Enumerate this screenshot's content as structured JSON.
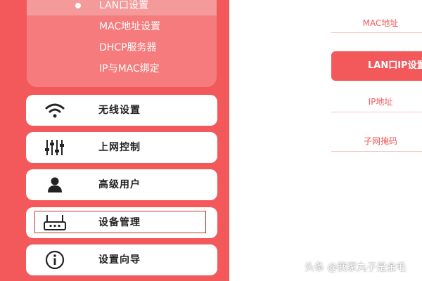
{
  "sidebar": {
    "submenu": [
      {
        "label": "LAN口设置",
        "active": true
      },
      {
        "label": "MAC地址设置",
        "active": false
      },
      {
        "label": "DHCP服务器",
        "active": false
      },
      {
        "label": "IP与MAC绑定",
        "active": false
      }
    ],
    "menu": [
      {
        "label": "无线设置",
        "icon": "wifi-icon"
      },
      {
        "label": "上网控制",
        "icon": "sliders-icon"
      },
      {
        "label": "高级用户",
        "icon": "user-icon"
      },
      {
        "label": "设备管理",
        "icon": "router-icon",
        "highlighted": true
      },
      {
        "label": "设置向导",
        "icon": "info-icon"
      }
    ]
  },
  "main": {
    "mac_label": "MAC地址",
    "lan_ip_button": "LAN口IP设置",
    "ip_label": "IP地址",
    "subnet_label": "子网掩码"
  },
  "watermark": "头条 @我家丸子是金毛",
  "colors": {
    "accent": "#f3585b",
    "submenu_bg": "#f57b7c",
    "highlight_border": "#c0392b"
  }
}
